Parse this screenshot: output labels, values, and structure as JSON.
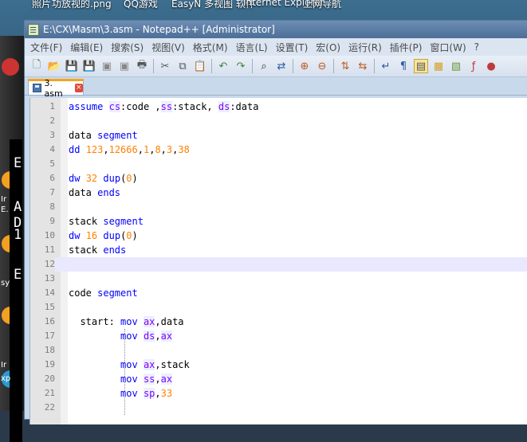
{
  "desktop": {
    "top_labels": [
      "照片",
      "功放视的.png",
      "QQ游戏",
      "EasyN 多视图 软件",
      "Internet Explorer",
      "上网导航"
    ],
    "side_labels": [
      "E",
      "A",
      "D",
      "1",
      "E"
    ],
    "side_texts": [
      "Ir",
      "E.",
      "sy",
      "Ir",
      "xp"
    ]
  },
  "window": {
    "title": "E:\\CX\\Masm\\3.asm - Notepad++ [Administrator]"
  },
  "menu": {
    "items": [
      "文件(F)",
      "编辑(E)",
      "搜索(S)",
      "视图(V)",
      "格式(M)",
      "语言(L)",
      "设置(T)",
      "宏(O)",
      "运行(R)",
      "插件(P)",
      "窗口(W)",
      "?"
    ]
  },
  "toolbar": {
    "icons": [
      "new-file-icon",
      "open-file-icon",
      "save-icon",
      "save-all-icon",
      "close-icon",
      "close-all-icon",
      "print-icon",
      "cut-icon",
      "copy-icon",
      "paste-icon",
      "undo-icon",
      "redo-icon",
      "find-icon",
      "replace-icon",
      "zoom-in-icon",
      "zoom-out-icon",
      "sync-v-icon",
      "sync-h-icon",
      "word-wrap-icon",
      "show-all-chars-icon",
      "indent-guide-icon",
      "user-lang-icon",
      "doc-map-icon",
      "function-list-icon",
      "macro-record-icon"
    ]
  },
  "tab": {
    "label": "3. asm",
    "close": "×"
  },
  "colors": {
    "keyword": "#0000ff",
    "register": "#8000ff",
    "number": "#ff8000",
    "current_line": "#e8e8ff",
    "tab_accent": "#f2a51f"
  },
  "editor": {
    "lines": [
      {
        "n": "1",
        "html": "<span class=\"kw\">assume</span> <span class=\"reg\">cs</span>:code ,<span class=\"reg\">ss</span>:stack, <span class=\"reg\">ds</span>:data"
      },
      {
        "n": "2",
        "html": ""
      },
      {
        "n": "3",
        "html": "data <span class=\"kw\">segment</span>"
      },
      {
        "n": "4",
        "html": "<span class=\"kw\">dd</span> <span class=\"num\">123</span>,<span class=\"num\">12666</span>,<span class=\"num\">1</span>,<span class=\"num\">8</span>,<span class=\"num\">3</span>,<span class=\"num\">38</span>"
      },
      {
        "n": "5",
        "html": ""
      },
      {
        "n": "6",
        "html": "<span class=\"kw\">dw</span> <span class=\"num\">32</span> <span class=\"kw\">dup</span>(<span class=\"num\">0</span>)"
      },
      {
        "n": "7",
        "html": "data <span class=\"kw\">ends</span>"
      },
      {
        "n": "8",
        "html": ""
      },
      {
        "n": "9",
        "html": "stack <span class=\"kw\">segment</span>"
      },
      {
        "n": "10",
        "html": "<span class=\"kw\">dw</span> <span class=\"num\">16</span> <span class=\"kw\">dup</span>(<span class=\"num\">0</span>)"
      },
      {
        "n": "11",
        "html": "stack <span class=\"kw\">ends</span>"
      },
      {
        "n": "12",
        "html": ""
      },
      {
        "n": "13",
        "html": ""
      },
      {
        "n": "14",
        "html": "code <span class=\"kw\">segment</span>"
      },
      {
        "n": "15",
        "html": ""
      },
      {
        "n": "16",
        "html": "  start: <span class=\"kw\">mov</span> <span class=\"reg\">ax</span>,data"
      },
      {
        "n": "17",
        "html": "         <span class=\"kw\">mov</span> <span class=\"reg\">ds</span>,<span class=\"reg\">ax</span>"
      },
      {
        "n": "18",
        "html": ""
      },
      {
        "n": "19",
        "html": "         <span class=\"kw\">mov</span> <span class=\"reg\">ax</span>,stack"
      },
      {
        "n": "20",
        "html": "         <span class=\"kw\">mov</span> <span class=\"reg\">ss</span>,<span class=\"reg\">ax</span>"
      },
      {
        "n": "21",
        "html": "         <span class=\"kw\">mov</span> <span class=\"reg\">sp</span>,<span class=\"num\">33</span>"
      },
      {
        "n": "22",
        "html": ""
      }
    ],
    "current_line": "12"
  }
}
